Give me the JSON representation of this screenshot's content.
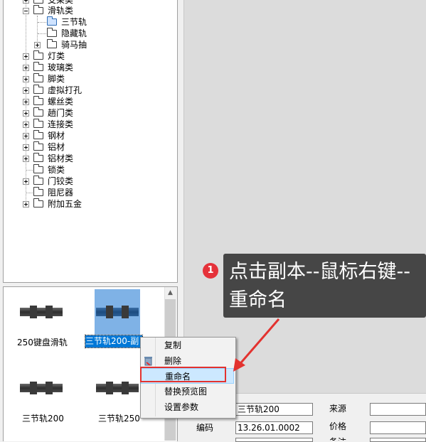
{
  "tree": {
    "items": [
      {
        "label": "支架类"
      },
      {
        "label": "滑轨类"
      },
      {
        "label": "三节轨"
      },
      {
        "label": "隐藏轨"
      },
      {
        "label": "骑马抽"
      },
      {
        "label": "灯类"
      },
      {
        "label": "玻璃类"
      },
      {
        "label": "脚类"
      },
      {
        "label": "虚拟打孔"
      },
      {
        "label": "螺丝类"
      },
      {
        "label": "趟门类"
      },
      {
        "label": "连接类"
      },
      {
        "label": "钢材"
      },
      {
        "label": "铝材"
      },
      {
        "label": "铝材类"
      },
      {
        "label": "锁类"
      },
      {
        "label": "门铰类"
      },
      {
        "label": "阻尼器"
      },
      {
        "label": "附加五金"
      }
    ]
  },
  "thumbnails": [
    {
      "caption": "250键盘滑轨"
    },
    {
      "caption": "三节轨200-副"
    },
    {
      "caption": "三节轨200"
    },
    {
      "caption": "三节轨250"
    }
  ],
  "context_menu": {
    "items": [
      {
        "label": "复制"
      },
      {
        "label": "删除"
      },
      {
        "label": "重命名"
      },
      {
        "label": "替换预览图"
      },
      {
        "label": "设置参数"
      }
    ]
  },
  "form": {
    "name_value": "三节轨200",
    "code_label": "编码",
    "code_value": "13.26.01.0002",
    "source_label": "来源",
    "price_label": "价格",
    "note_label": "备注"
  },
  "callout": {
    "badge": "1",
    "text": "点击副本--鼠标右键--重命名"
  },
  "colors": {
    "selection": "#0078d7",
    "menu_highlight": "#cce8ff",
    "red_box": "#e3322f",
    "callout_bg": "#3a3a3a",
    "badge": "#e5323a"
  }
}
